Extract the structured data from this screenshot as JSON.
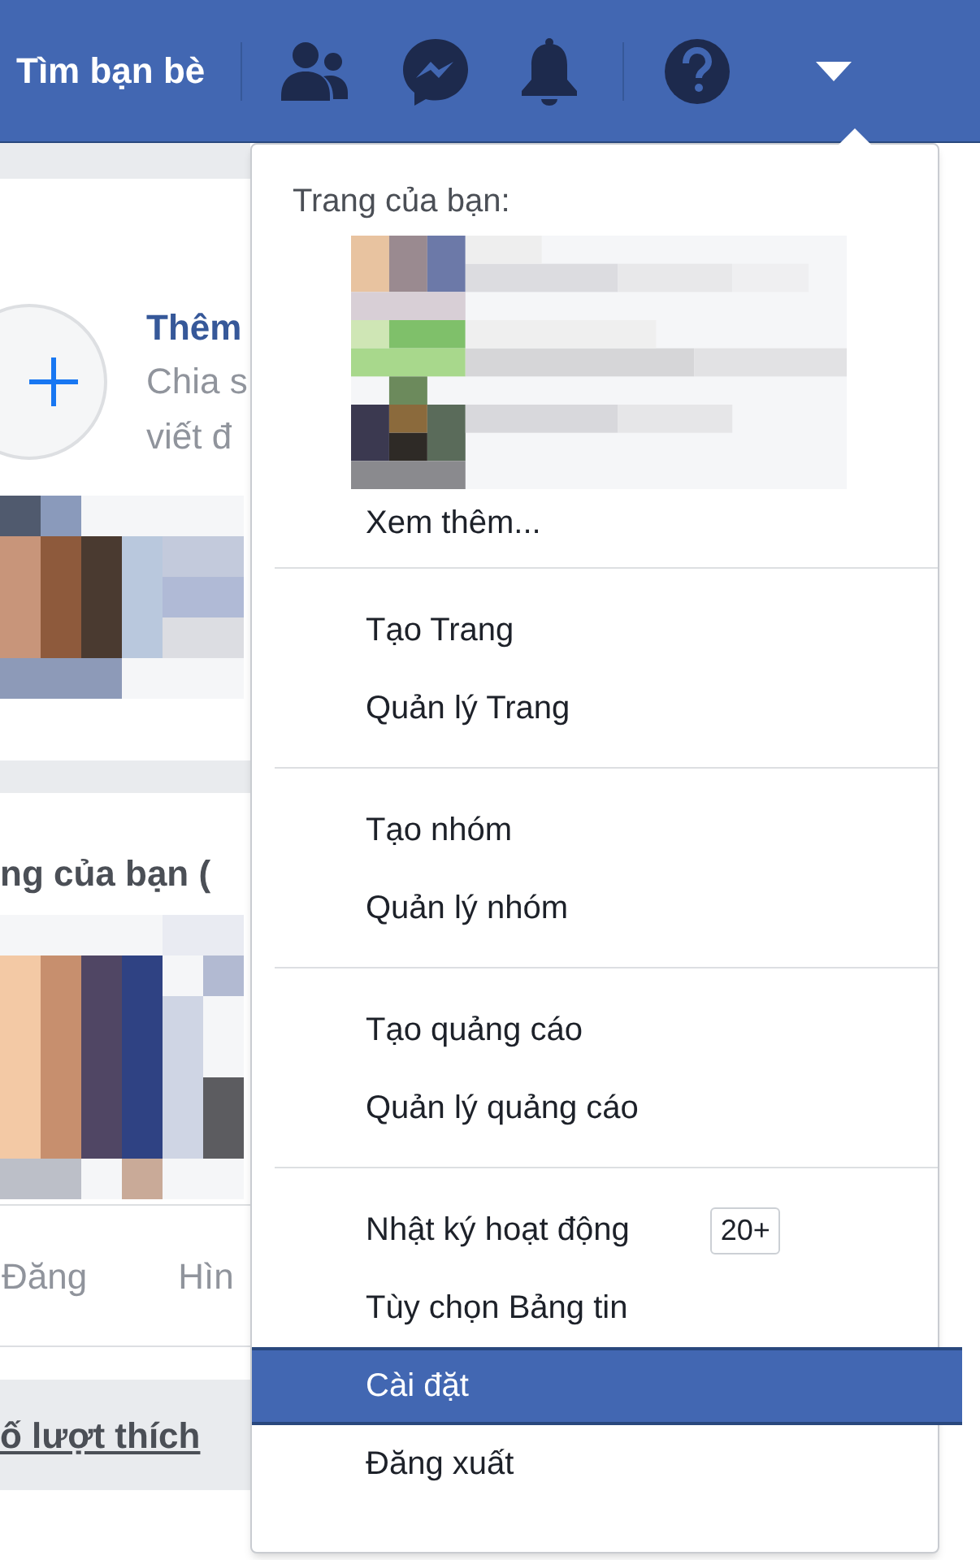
{
  "header": {
    "find_friends": "Tìm bạn bè"
  },
  "background": {
    "add_story_title": "Thêm",
    "add_story_lines": [
      "Chia s",
      "viết đ"
    ],
    "section_title": "ng của bạn (",
    "tabs": [
      "Đăng",
      "Hìn"
    ],
    "like_count_link": "ố lượt thích"
  },
  "menu": {
    "heading": "Trang của bạn:",
    "pages": [
      {
        "kind": "picture"
      },
      {
        "kind": "picture"
      },
      {
        "kind": "picture"
      }
    ],
    "see_more": "Xem thêm...",
    "groups": [
      [
        {
          "label": "Tạo Trang",
          "selected": false
        },
        {
          "label": "Quản lý Trang",
          "selected": false
        }
      ],
      [
        {
          "label": "Tạo nhóm",
          "selected": false
        },
        {
          "label": "Quản lý nhóm",
          "selected": false
        }
      ],
      [
        {
          "label": "Tạo quảng cáo",
          "selected": false
        },
        {
          "label": "Quản lý quảng cáo",
          "selected": false
        }
      ],
      [
        {
          "label": "Nhật ký hoạt động",
          "selected": false,
          "badge": "20+"
        },
        {
          "label": "Tùy chọn Bảng tin",
          "selected": false
        },
        {
          "label": "Cài đặt",
          "selected": true
        },
        {
          "label": "Đăng xuất",
          "selected": false
        }
      ]
    ]
  }
}
